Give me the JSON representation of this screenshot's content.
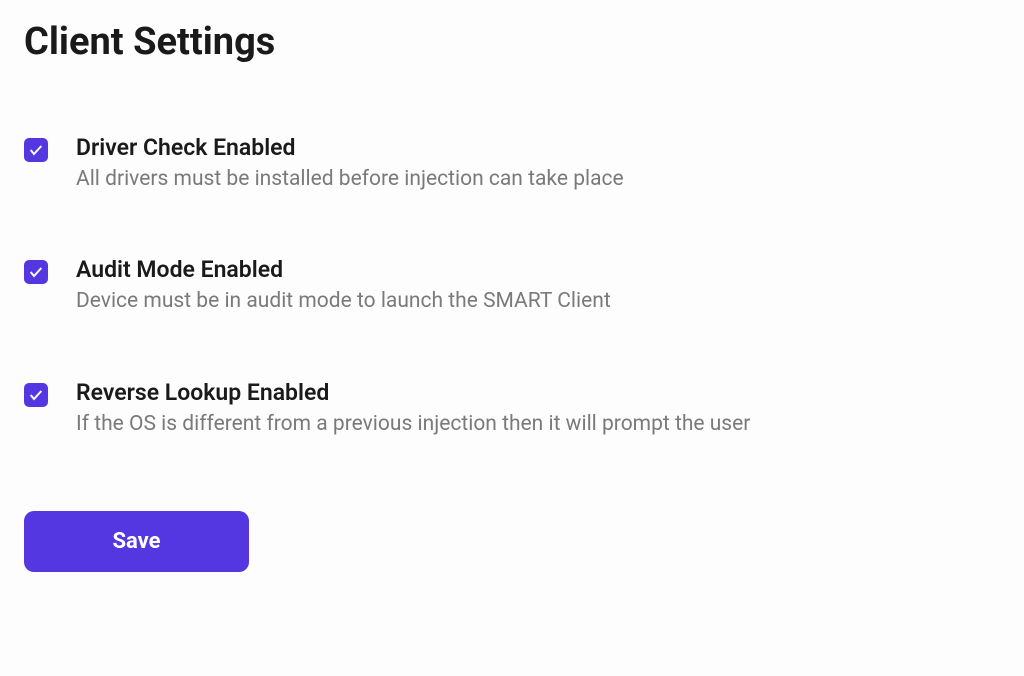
{
  "title": "Client Settings",
  "colors": {
    "accent": "#5437e0"
  },
  "settings": [
    {
      "checked": true,
      "label": "Driver Check Enabled",
      "description": "All drivers must be installed before injection can take place"
    },
    {
      "checked": true,
      "label": "Audit Mode Enabled",
      "description": "Device must be in audit mode to launch the SMART Client"
    },
    {
      "checked": true,
      "label": "Reverse Lookup Enabled",
      "description": "If the OS is different from a previous injection then it will prompt the user"
    }
  ],
  "actions": {
    "save_label": "Save"
  }
}
